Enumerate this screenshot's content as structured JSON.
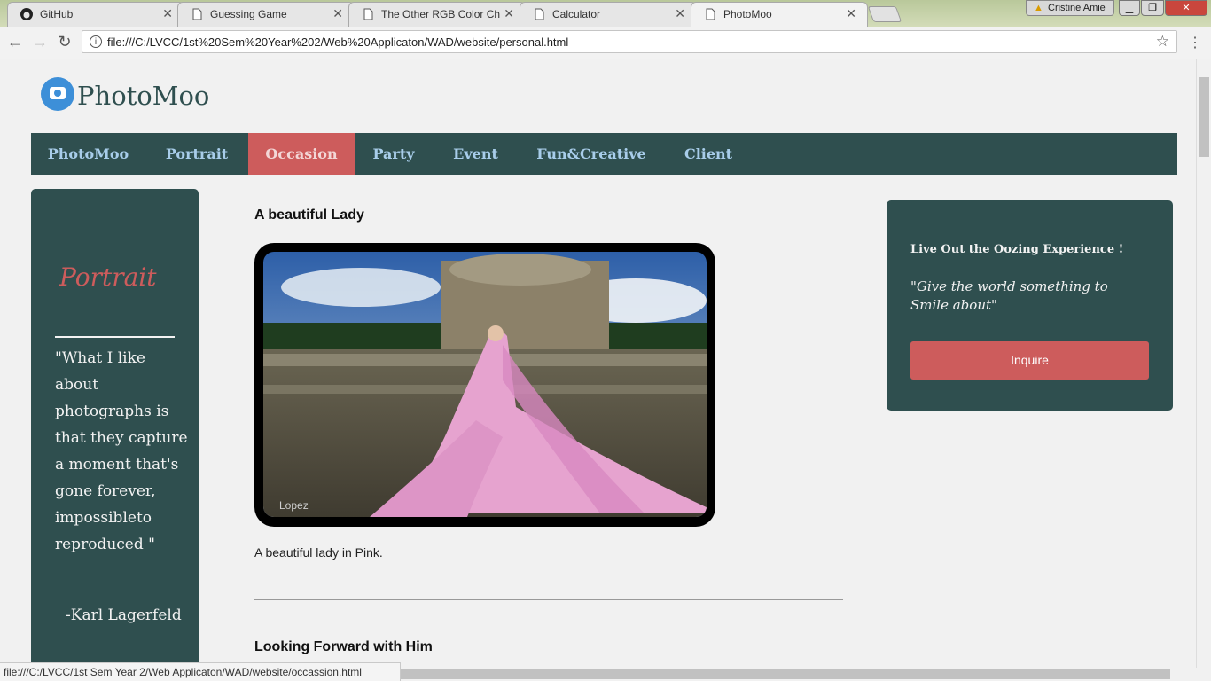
{
  "browser": {
    "tabs": [
      {
        "title": "GitHub",
        "icon": "github-icon"
      },
      {
        "title": "Guessing Game",
        "icon": "page-icon"
      },
      {
        "title": "The Other RGB Color Ch",
        "icon": "page-icon"
      },
      {
        "title": "Calculator",
        "icon": "page-icon"
      },
      {
        "title": "PhotoMoo",
        "icon": "page-icon"
      }
    ],
    "user": "Cristine Amie",
    "url": "file:///C:/LVCC/1st%20Sem%20Year%202/Web%20Applicaton/WAD/website/personal.html",
    "status_url": "file:///C:/LVCC/1st Sem Year 2/Web Applicaton/WAD/website/occassion.html"
  },
  "site": {
    "brand": "PhotoMoo",
    "nav": [
      "PhotoMoo",
      "Portrait",
      "Occasion",
      "Party",
      "Event",
      "Fun&Creative",
      "Client"
    ],
    "active_nav": "Occasion"
  },
  "sidebar": {
    "heading": "Portrait",
    "quote": "\"What I like about photographs is that they capture a moment that's gone forever, impossibleto reproduced \"",
    "author": "-Karl Lagerfeld"
  },
  "main": {
    "section1_title": "A beautiful Lady",
    "photo_watermark": "Lopez",
    "section1_caption": "A beautiful lady in Pink.",
    "section2_title": "Looking Forward with Him"
  },
  "aside": {
    "tagline": "Live Out the Oozing Experience !",
    "quote": "\"Give the world something to Smile about\"",
    "button": "Inquire"
  },
  "colors": {
    "panel": "#2f4f4f",
    "accent": "#cd5c5c",
    "nav_text": "#a8cdea"
  }
}
